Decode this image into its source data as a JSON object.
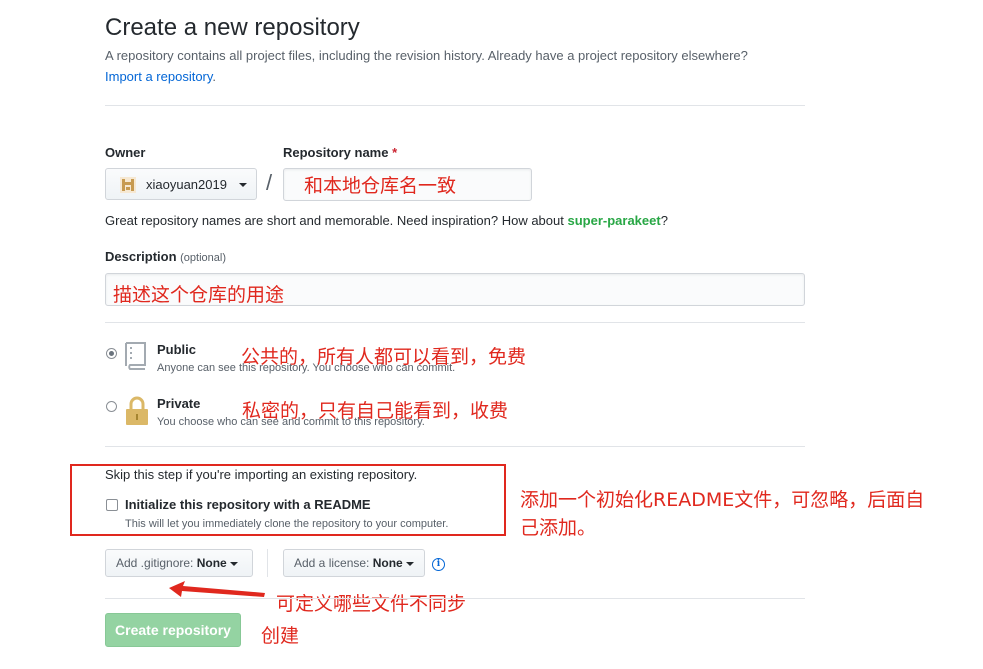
{
  "header": {
    "title": "Create a new repository",
    "subtitle": "A repository contains all project files, including the revision history. Already have a project repository elsewhere?",
    "import_link": "Import a repository",
    "import_period": "."
  },
  "owner": {
    "label": "Owner",
    "value": "xiaoyuan2019"
  },
  "repo": {
    "label": "Repository name",
    "required_mark": "*",
    "slash": "/",
    "value": ""
  },
  "hint": {
    "before": "Great repository names are short and memorable. Need inspiration? How about",
    "suggestion": "super-parakeet",
    "after": "?"
  },
  "description": {
    "label": "Description",
    "optional": "(optional)",
    "value": ""
  },
  "visibility": {
    "public": {
      "title": "Public",
      "note": "Anyone can see this repository. You choose who can commit.",
      "selected": true
    },
    "private": {
      "title": "Private",
      "note": "You choose who can see and commit to this repository.",
      "selected": false
    }
  },
  "init": {
    "skip_text": "Skip this step if you're importing an existing repository.",
    "checkbox_label": "Initialize this repository with a README",
    "checkbox_note": "This will let you immediately clone the repository to your computer.",
    "checked": false
  },
  "gitignore": {
    "label": "Add .gitignore:",
    "value": "None"
  },
  "license": {
    "label": "Add a license:",
    "value": "None"
  },
  "info_icon_glyph": "i",
  "create_button": "Create repository",
  "annotations": {
    "repo_name": "和本地仓库名一致",
    "description": "描述这个仓库的用途",
    "public": "公共的，所有人都可以看到，免费",
    "private": "私密的，只有自己能看到，收费",
    "readme_line1": "添加一个初始化README文件，可忽略，后面自",
    "readme_line2": "己添加。",
    "gitignore": "可定义哪些文件不同步",
    "create": "创建"
  },
  "colors": {
    "annotation_red": "#e0281e",
    "link_blue": "#0366d6",
    "suggestion_green": "#28a745",
    "create_button_green": "#94d3a2"
  },
  "icons": {
    "owner_avatar": "identicon-avatar",
    "public": "repo-book-icon",
    "private": "lock-icon",
    "dropdown": "caret-down-icon",
    "info": "info-icon",
    "arrow": "red-arrow-left-icon"
  }
}
